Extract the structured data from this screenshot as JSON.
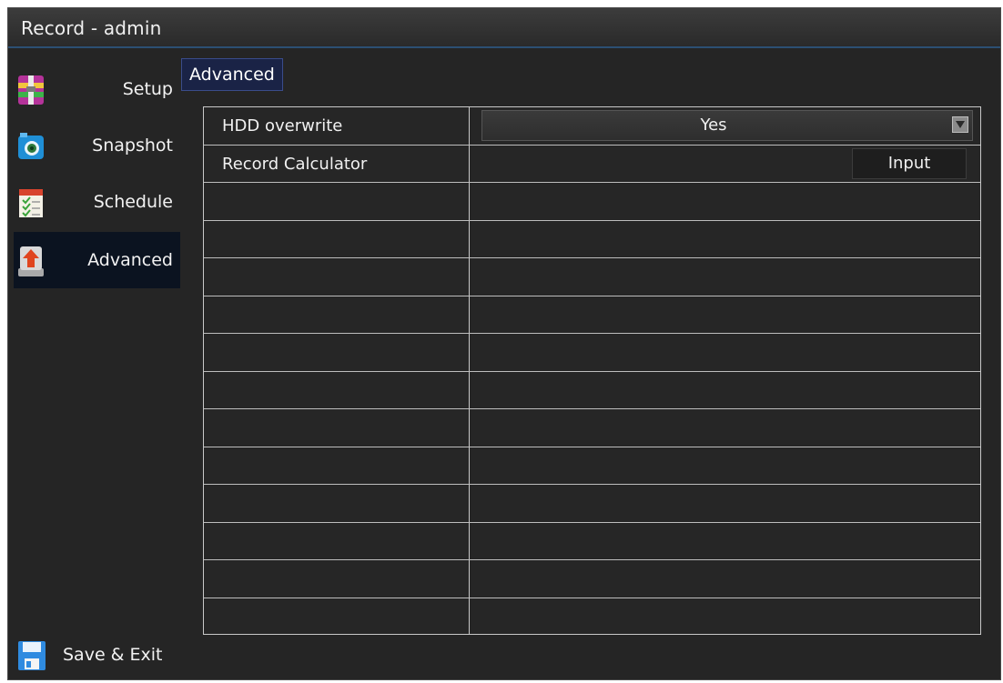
{
  "window": {
    "title": "Record - admin"
  },
  "sidebar": {
    "items": [
      {
        "label": "Setup",
        "icon": "setup-archive-icon",
        "active": false
      },
      {
        "label": "Snapshot",
        "icon": "camera-icon",
        "active": false
      },
      {
        "label": "Schedule",
        "icon": "schedule-checklist-icon",
        "active": false
      },
      {
        "label": "Advanced",
        "icon": "advanced-upload-icon",
        "active": true
      }
    ],
    "save_exit": {
      "label": "Save & Exit",
      "icon": "floppy-disk-icon"
    }
  },
  "tab": {
    "label": "Advanced"
  },
  "settings": {
    "rows": [
      {
        "label": "HDD overwrite",
        "value": "Yes",
        "control": "dropdown"
      },
      {
        "label": "Record Calculator",
        "button": "Input",
        "control": "button"
      }
    ],
    "empty_rows": 12
  },
  "colors": {
    "background": "#252525",
    "title_underline": "#2c4f73",
    "tab_bg": "#1a2346",
    "active_item_bg": "#0b1320",
    "grid_lines": "#c8c8c8"
  }
}
